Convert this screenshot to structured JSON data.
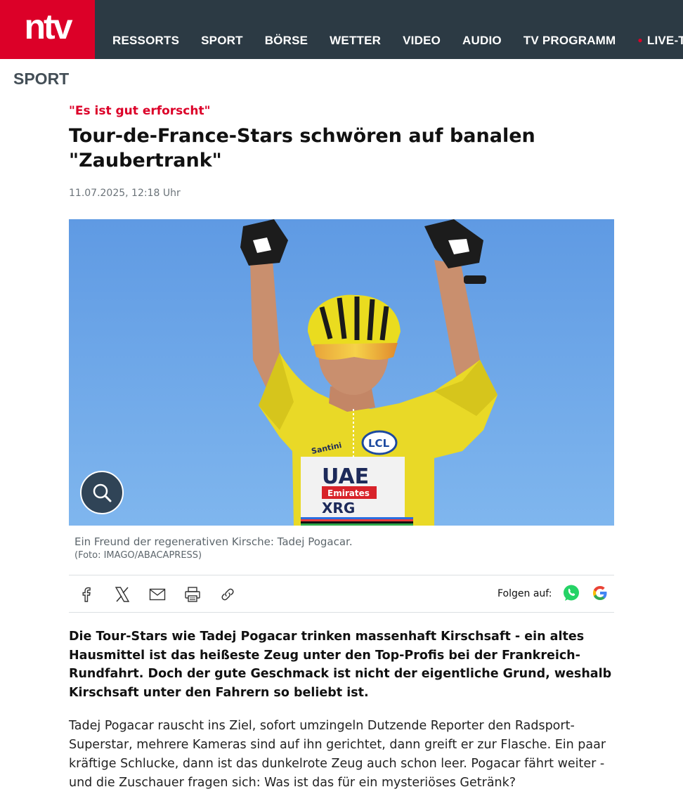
{
  "header": {
    "logo_text": "ntv",
    "brand_color": "#dc0028",
    "bar_color": "#2c3a44",
    "nav": [
      "RESSORTS",
      "SPORT",
      "BÖRSE",
      "WETTER",
      "VIDEO",
      "AUDIO",
      "TV PROGRAMM"
    ],
    "live_label": "LIVE-TV"
  },
  "section": {
    "label": "SPORT"
  },
  "article": {
    "kicker": "\"Es ist gut erforscht\"",
    "headline": "Tour-de-France-Stars schwören auf banalen \"Zaubertrank\"",
    "date": "11.07.2025, 12:18 Uhr",
    "image": {
      "jersey_text": [
        "UAE",
        "Emirates",
        "XRG",
        "LCL",
        "Santini"
      ],
      "caption": "Ein Freund der regenerativen Kirsche: Tadej Pogacar.",
      "credit": "(Foto: IMAGO/ABACAPRESS)"
    },
    "share": {
      "icons": [
        "facebook-icon",
        "x-icon",
        "mail-icon",
        "print-icon",
        "link-icon"
      ],
      "follow_label": "Folgen auf:",
      "follow_icons": [
        "whatsapp-icon",
        "google-icon"
      ]
    },
    "lead": "Die Tour-Stars wie Tadej Pogacar trinken massenhaft Kirschsaft - ein altes Hausmittel ist das heißeste Zeug unter den Top-Profis bei der Frankreich-Rundfahrt. Doch der gute Geschmack ist nicht der eigentliche Grund, weshalb Kirschsaft unter den Fahrern so beliebt ist.",
    "paragraph": "Tadej Pogacar rauscht ins Ziel, sofort umzingeln Dutzende Reporter den Radsport-Superstar, mehrere Kameras sind auf ihn gerichtet, dann greift er zur Flasche. Ein paar kräftige Schlucke, dann ist das dunkelrote Zeug auch schon leer. Pogacar fährt weiter - und die Zuschauer fragen sich: Was ist das für ein mysteriöses Getränk?"
  }
}
